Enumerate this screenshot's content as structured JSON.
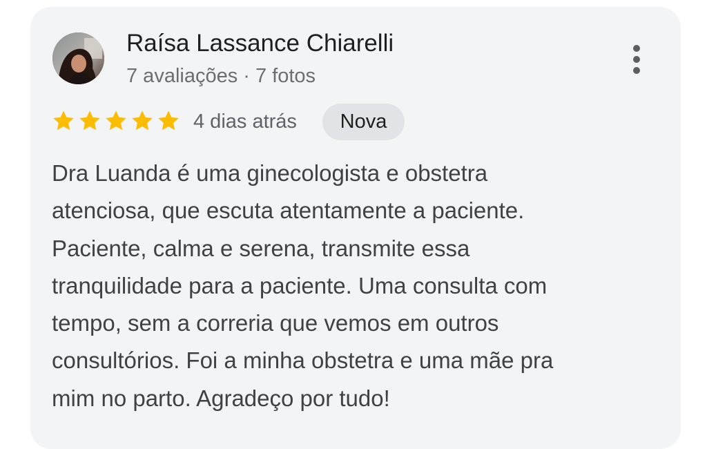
{
  "review": {
    "reviewer": {
      "name": "Raísa Lassance Chiarelli",
      "meta": "7 avaliações · 7 fotos",
      "avatar_icon": "profile-photo"
    },
    "menu_icon": "more-vertical-icon",
    "rating": {
      "stars": 5,
      "max": 5,
      "color": "#fbbc04"
    },
    "date": "4 dias atrás",
    "badge": "Nova",
    "text_lines": [
      "Dra Luanda é uma ginecologista e obstetra",
      "atenciosa, que escuta atentamente a paciente.",
      "Paciente, calma e serena, transmite essa",
      "tranquilidade para a paciente. Uma consulta com",
      "tempo, sem a correria que vemos em outros",
      "consultórios. Foi a minha obstetra e uma mãe pra",
      "mim no parto. Agradeço por tudo!"
    ]
  }
}
